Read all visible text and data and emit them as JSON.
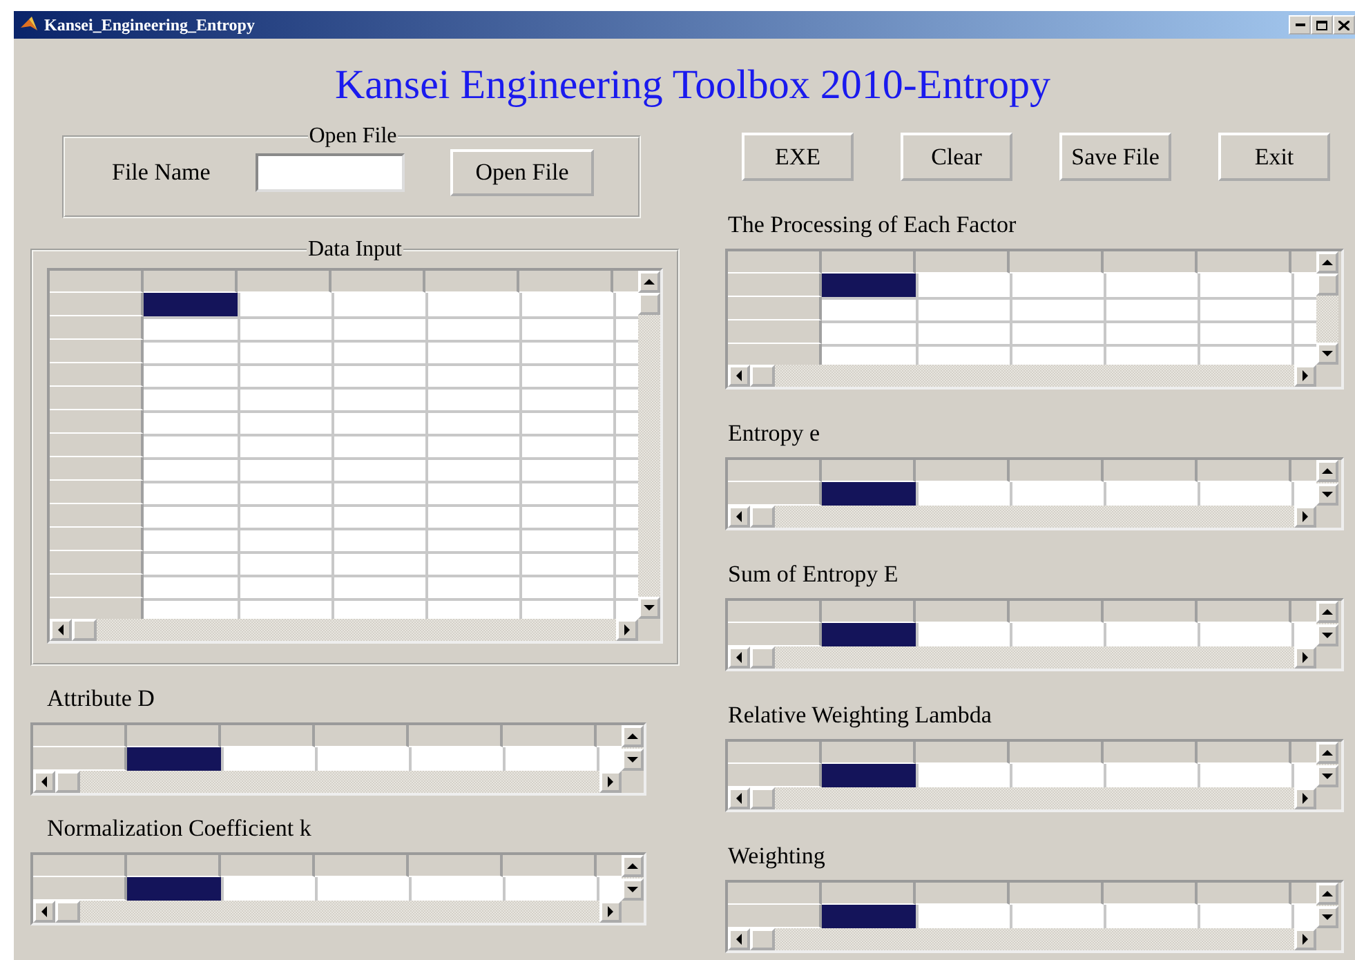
{
  "window": {
    "title": "Kansei_Engineering_Entropy"
  },
  "heading": "Kansei Engineering Toolbox 2010-Entropy",
  "open_file": {
    "legend": "Open File",
    "label": "File Name",
    "button": "Open File"
  },
  "buttons": [
    "EXE",
    "Clear",
    "Save File",
    "Exit"
  ],
  "data_input": {
    "legend": "Data Input",
    "grid": {
      "rows": [
        {
          "cells": [
            {
              "selected": true
            },
            {
              "selected": false
            },
            {
              "selected": false
            },
            {
              "selected": false
            },
            {
              "selected": false
            },
            {
              "selected": false
            }
          ]
        },
        {
          "cells": [
            {
              "selected": false
            },
            {
              "selected": false
            },
            {
              "selected": false
            },
            {
              "selected": false
            },
            {
              "selected": false
            },
            {
              "selected": false
            }
          ]
        },
        {
          "cells": [
            {
              "selected": false
            },
            {
              "selected": false
            },
            {
              "selected": false
            },
            {
              "selected": false
            },
            {
              "selected": false
            },
            {
              "selected": false
            }
          ]
        },
        {
          "cells": [
            {
              "selected": false
            },
            {
              "selected": false
            },
            {
              "selected": false
            },
            {
              "selected": false
            },
            {
              "selected": false
            },
            {
              "selected": false
            }
          ]
        },
        {
          "cells": [
            {
              "selected": false
            },
            {
              "selected": false
            },
            {
              "selected": false
            },
            {
              "selected": false
            },
            {
              "selected": false
            },
            {
              "selected": false
            }
          ]
        },
        {
          "cells": [
            {
              "selected": false
            },
            {
              "selected": false
            },
            {
              "selected": false
            },
            {
              "selected": false
            },
            {
              "selected": false
            },
            {
              "selected": false
            }
          ]
        },
        {
          "cells": [
            {
              "selected": false
            },
            {
              "selected": false
            },
            {
              "selected": false
            },
            {
              "selected": false
            },
            {
              "selected": false
            },
            {
              "selected": false
            }
          ]
        },
        {
          "cells": [
            {
              "selected": false
            },
            {
              "selected": false
            },
            {
              "selected": false
            },
            {
              "selected": false
            },
            {
              "selected": false
            },
            {
              "selected": false
            }
          ]
        },
        {
          "cells": [
            {
              "selected": false
            },
            {
              "selected": false
            },
            {
              "selected": false
            },
            {
              "selected": false
            },
            {
              "selected": false
            },
            {
              "selected": false
            }
          ]
        },
        {
          "cells": [
            {
              "selected": false
            },
            {
              "selected": false
            },
            {
              "selected": false
            },
            {
              "selected": false
            },
            {
              "selected": false
            },
            {
              "selected": false
            }
          ]
        },
        {
          "cells": [
            {
              "selected": false
            },
            {
              "selected": false
            },
            {
              "selected": false
            },
            {
              "selected": false
            },
            {
              "selected": false
            },
            {
              "selected": false
            }
          ]
        },
        {
          "cells": [
            {
              "selected": false
            },
            {
              "selected": false
            },
            {
              "selected": false
            },
            {
              "selected": false
            },
            {
              "selected": false
            },
            {
              "selected": false
            }
          ]
        },
        {
          "cells": [
            {
              "selected": false
            },
            {
              "selected": false
            },
            {
              "selected": false
            },
            {
              "selected": false
            },
            {
              "selected": false
            },
            {
              "selected": false
            }
          ]
        },
        {
          "cells": [
            {
              "selected": false
            },
            {
              "selected": false
            },
            {
              "selected": false
            },
            {
              "selected": false
            },
            {
              "selected": false
            },
            {
              "selected": false
            }
          ]
        }
      ]
    }
  },
  "left_outputs": [
    {
      "label": "Attribute D",
      "grid": {
        "rows": [
          {
            "cells": [
              {
                "selected": true
              },
              {
                "selected": false
              },
              {
                "selected": false
              },
              {
                "selected": false
              },
              {
                "selected": false
              },
              {
                "selected": false
              }
            ]
          }
        ]
      }
    },
    {
      "label": "Normalization Coefficient k",
      "grid": {
        "rows": [
          {
            "cells": [
              {
                "selected": true
              },
              {
                "selected": false
              },
              {
                "selected": false
              },
              {
                "selected": false
              },
              {
                "selected": false
              },
              {
                "selected": false
              }
            ]
          }
        ]
      }
    }
  ],
  "right_outputs": [
    {
      "label": "The Processing of Each Factor",
      "grid": {
        "rows": [
          {
            "cells": [
              {
                "selected": true
              },
              {
                "selected": false
              },
              {
                "selected": false
              },
              {
                "selected": false
              },
              {
                "selected": false
              },
              {
                "selected": false
              }
            ]
          },
          {
            "cells": [
              {
                "selected": false
              },
              {
                "selected": false
              },
              {
                "selected": false
              },
              {
                "selected": false
              },
              {
                "selected": false
              },
              {
                "selected": false
              }
            ]
          },
          {
            "cells": [
              {
                "selected": false
              },
              {
                "selected": false
              },
              {
                "selected": false
              },
              {
                "selected": false
              },
              {
                "selected": false
              },
              {
                "selected": false
              }
            ]
          },
          {
            "cells": [
              {
                "selected": false
              },
              {
                "selected": false
              },
              {
                "selected": false
              },
              {
                "selected": false
              },
              {
                "selected": false
              },
              {
                "selected": false
              }
            ]
          }
        ]
      }
    },
    {
      "label": "Entropy e",
      "grid": {
        "rows": [
          {
            "cells": [
              {
                "selected": true
              },
              {
                "selected": false
              },
              {
                "selected": false
              },
              {
                "selected": false
              },
              {
                "selected": false
              },
              {
                "selected": false
              }
            ]
          }
        ]
      }
    },
    {
      "label": "Sum of Entropy E",
      "grid": {
        "rows": [
          {
            "cells": [
              {
                "selected": true
              },
              {
                "selected": false
              },
              {
                "selected": false
              },
              {
                "selected": false
              },
              {
                "selected": false
              },
              {
                "selected": false
              }
            ]
          }
        ]
      }
    },
    {
      "label": "Relative Weighting Lambda",
      "grid": {
        "rows": [
          {
            "cells": [
              {
                "selected": true
              },
              {
                "selected": false
              },
              {
                "selected": false
              },
              {
                "selected": false
              },
              {
                "selected": false
              },
              {
                "selected": false
              }
            ]
          }
        ]
      }
    },
    {
      "label": "Weighting",
      "grid": {
        "rows": [
          {
            "cells": [
              {
                "selected": true
              },
              {
                "selected": false
              },
              {
                "selected": false
              },
              {
                "selected": false
              },
              {
                "selected": false
              },
              {
                "selected": false
              }
            ]
          }
        ]
      }
    }
  ]
}
